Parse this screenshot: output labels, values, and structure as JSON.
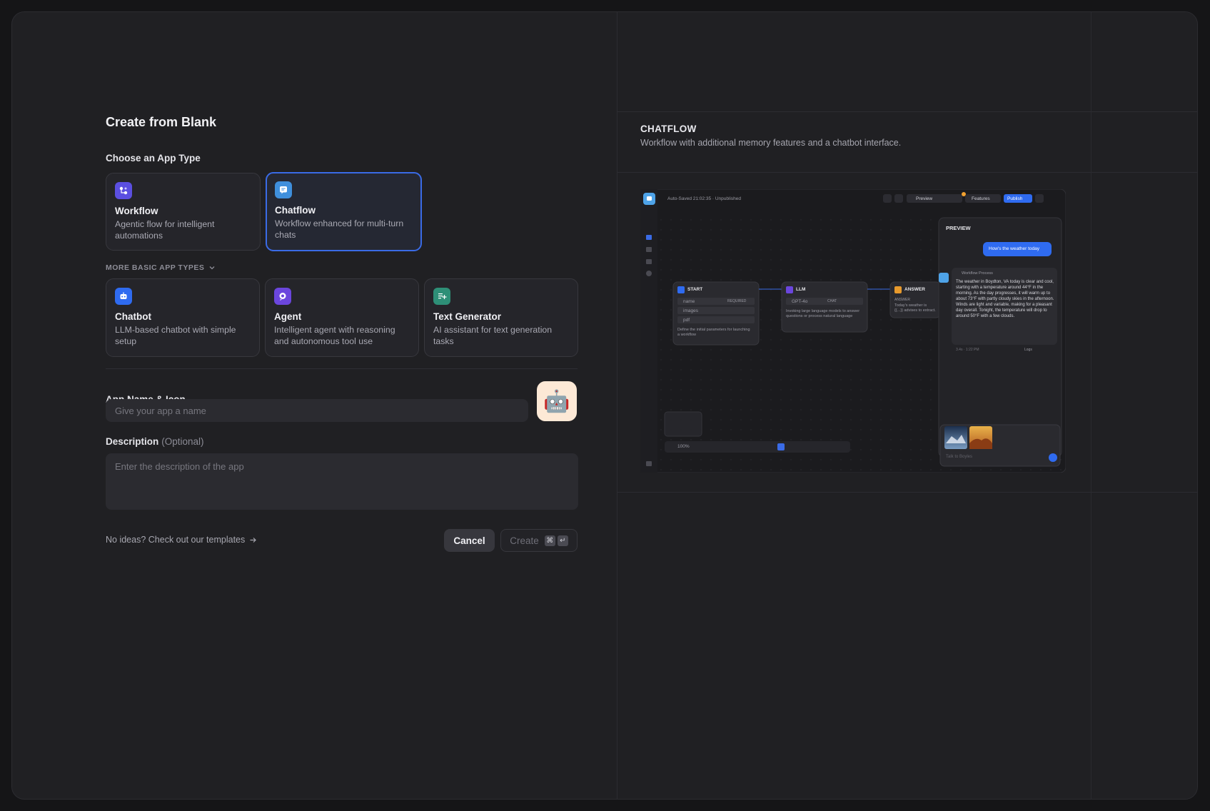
{
  "title": "Create from Blank",
  "choose_label": "Choose an App Type",
  "app_types": [
    {
      "name": "Workflow",
      "desc": "Agentic flow for intelligent automations",
      "icon": "workflow-icon",
      "color": "#5b4fe0",
      "selected": false
    },
    {
      "name": "Chatflow",
      "desc": "Workflow enhanced for multi-turn chats",
      "icon": "chatflow-icon",
      "color": "#3f8fdc",
      "selected": true
    }
  ],
  "more_label": "MORE BASIC APP TYPES",
  "basic_types": [
    {
      "name": "Chatbot",
      "desc": "LLM-based chatbot with simple setup",
      "icon": "chatbot-icon",
      "color": "#2f6bf0"
    },
    {
      "name": "Agent",
      "desc": "Intelligent agent with reasoning and autonomous tool use",
      "icon": "agent-icon",
      "color": "#6b46dd"
    },
    {
      "name": "Text Generator",
      "desc": "AI assistant for text generation tasks",
      "icon": "text-generator-icon",
      "color": "#2e8f77"
    }
  ],
  "name_label": "App Name & Icon",
  "name_placeholder": "Give your app a name",
  "app_icon_emoji": "🤖",
  "desc_label": "Description",
  "desc_optional": "(Optional)",
  "desc_placeholder": "Enter the description of the app",
  "templates_link": "No ideas? Check out our templates",
  "cancel_label": "Cancel",
  "create_label": "Create",
  "create_keys": [
    "⌘",
    "↵"
  ],
  "preview": {
    "title": "CHATFLOW",
    "desc": "Workflow with additional memory features and a chatbot interface.",
    "topbar_status": "Auto-Saved 21:02:35 · Unpublished",
    "topbar_buttons": [
      "Preview",
      "Features",
      "Publish"
    ],
    "nodes": [
      {
        "title": "START",
        "rows": [
          "name",
          "images",
          "pdf"
        ],
        "badge": "REQUIRED",
        "note": "Define the initial parameters for launching a workflow"
      },
      {
        "title": "LLM",
        "rows": [
          "GPT-4o"
        ],
        "badge": "CHAT",
        "note": "Invoking large language models to answer questions or process natural language"
      },
      {
        "title": "ANSWER",
        "rows": [
          "ANSWER"
        ],
        "badge": "",
        "note": "Today's weather is {{...}} advises to extract."
      }
    ],
    "panel_title": "PREVIEW",
    "user_msg": "How's the weather today",
    "process_label": "Workflow Process",
    "bot_reply": "The weather in Boydton, VA today is clear and cool, starting with a temperature around 44°F in the morning. As the day progresses, it will warm up to about 73°F with partly cloudy skies in the afternoon. Winds are light and variable, making for a pleasant day overall. Tonight, the temperature will drop to around 50°F with a few clouds.",
    "reply_meta": "3.4s · 1:22 PM",
    "logs_label": "Logs",
    "chat_placeholder": "Talk to Boyles",
    "zoom": "100%"
  }
}
